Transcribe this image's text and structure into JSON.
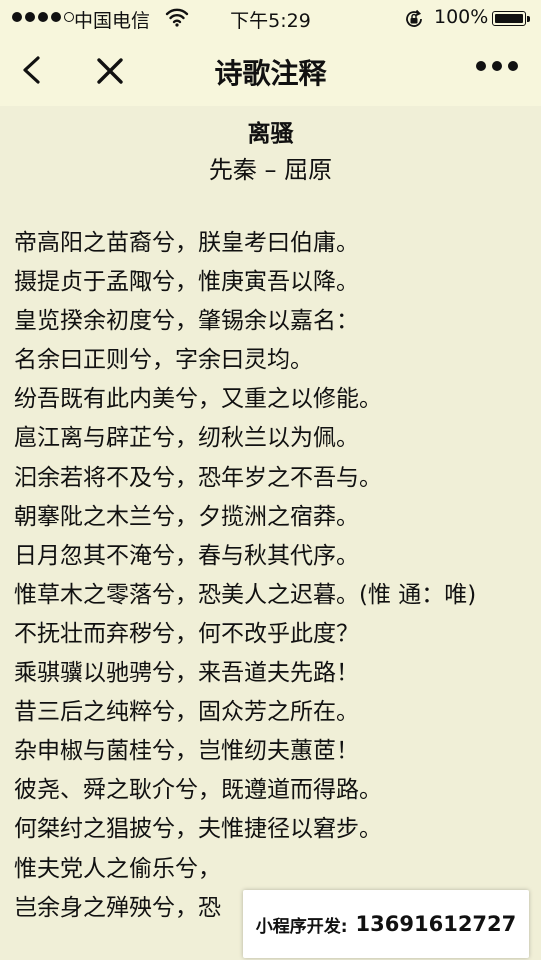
{
  "status_bar": {
    "carrier": "中国电信",
    "time": "下午5:29",
    "battery": "100%"
  },
  "nav": {
    "title": "诗歌注释",
    "back_icon": "chevron-left-icon",
    "close_icon": "close-icon",
    "more_icon": "more-dots-icon"
  },
  "poem": {
    "title": "离骚",
    "author": "先秦 – 屈原",
    "lines": [
      "帝高阳之苗裔兮，朕皇考曰伯庸。",
      "摄提贞于孟陬兮，惟庚寅吾以降。",
      "皇览揆余初度兮，肇锡余以嘉名：",
      "名余曰正则兮，字余曰灵均。",
      "纷吾既有此内美兮，又重之以修能。",
      "扈江离与辟芷兮，纫秋兰以为佩。",
      "汩余若将不及兮，恐年岁之不吾与。",
      "朝搴阰之木兰兮，夕揽洲之宿莽。",
      "日月忽其不淹兮，春与秋其代序。",
      "惟草木之零落兮，恐美人之迟暮。(惟 通：唯)",
      "不抚壮而弃秽兮，何不改乎此度？",
      "乘骐骥以驰骋兮，来吾道夫先路！",
      "昔三后之纯粹兮，固众芳之所在。",
      "杂申椒与菌桂兮，岂惟纫夫蕙茝！",
      "彼尧、舜之耿介兮，既遵道而得路。",
      "何桀纣之猖披兮，夫惟捷径以窘步。",
      "惟夫党人之偷乐兮，",
      "岂余身之殚殃兮，恐"
    ]
  },
  "promo": {
    "label": "小程序开发:",
    "phone": "13691612727"
  }
}
